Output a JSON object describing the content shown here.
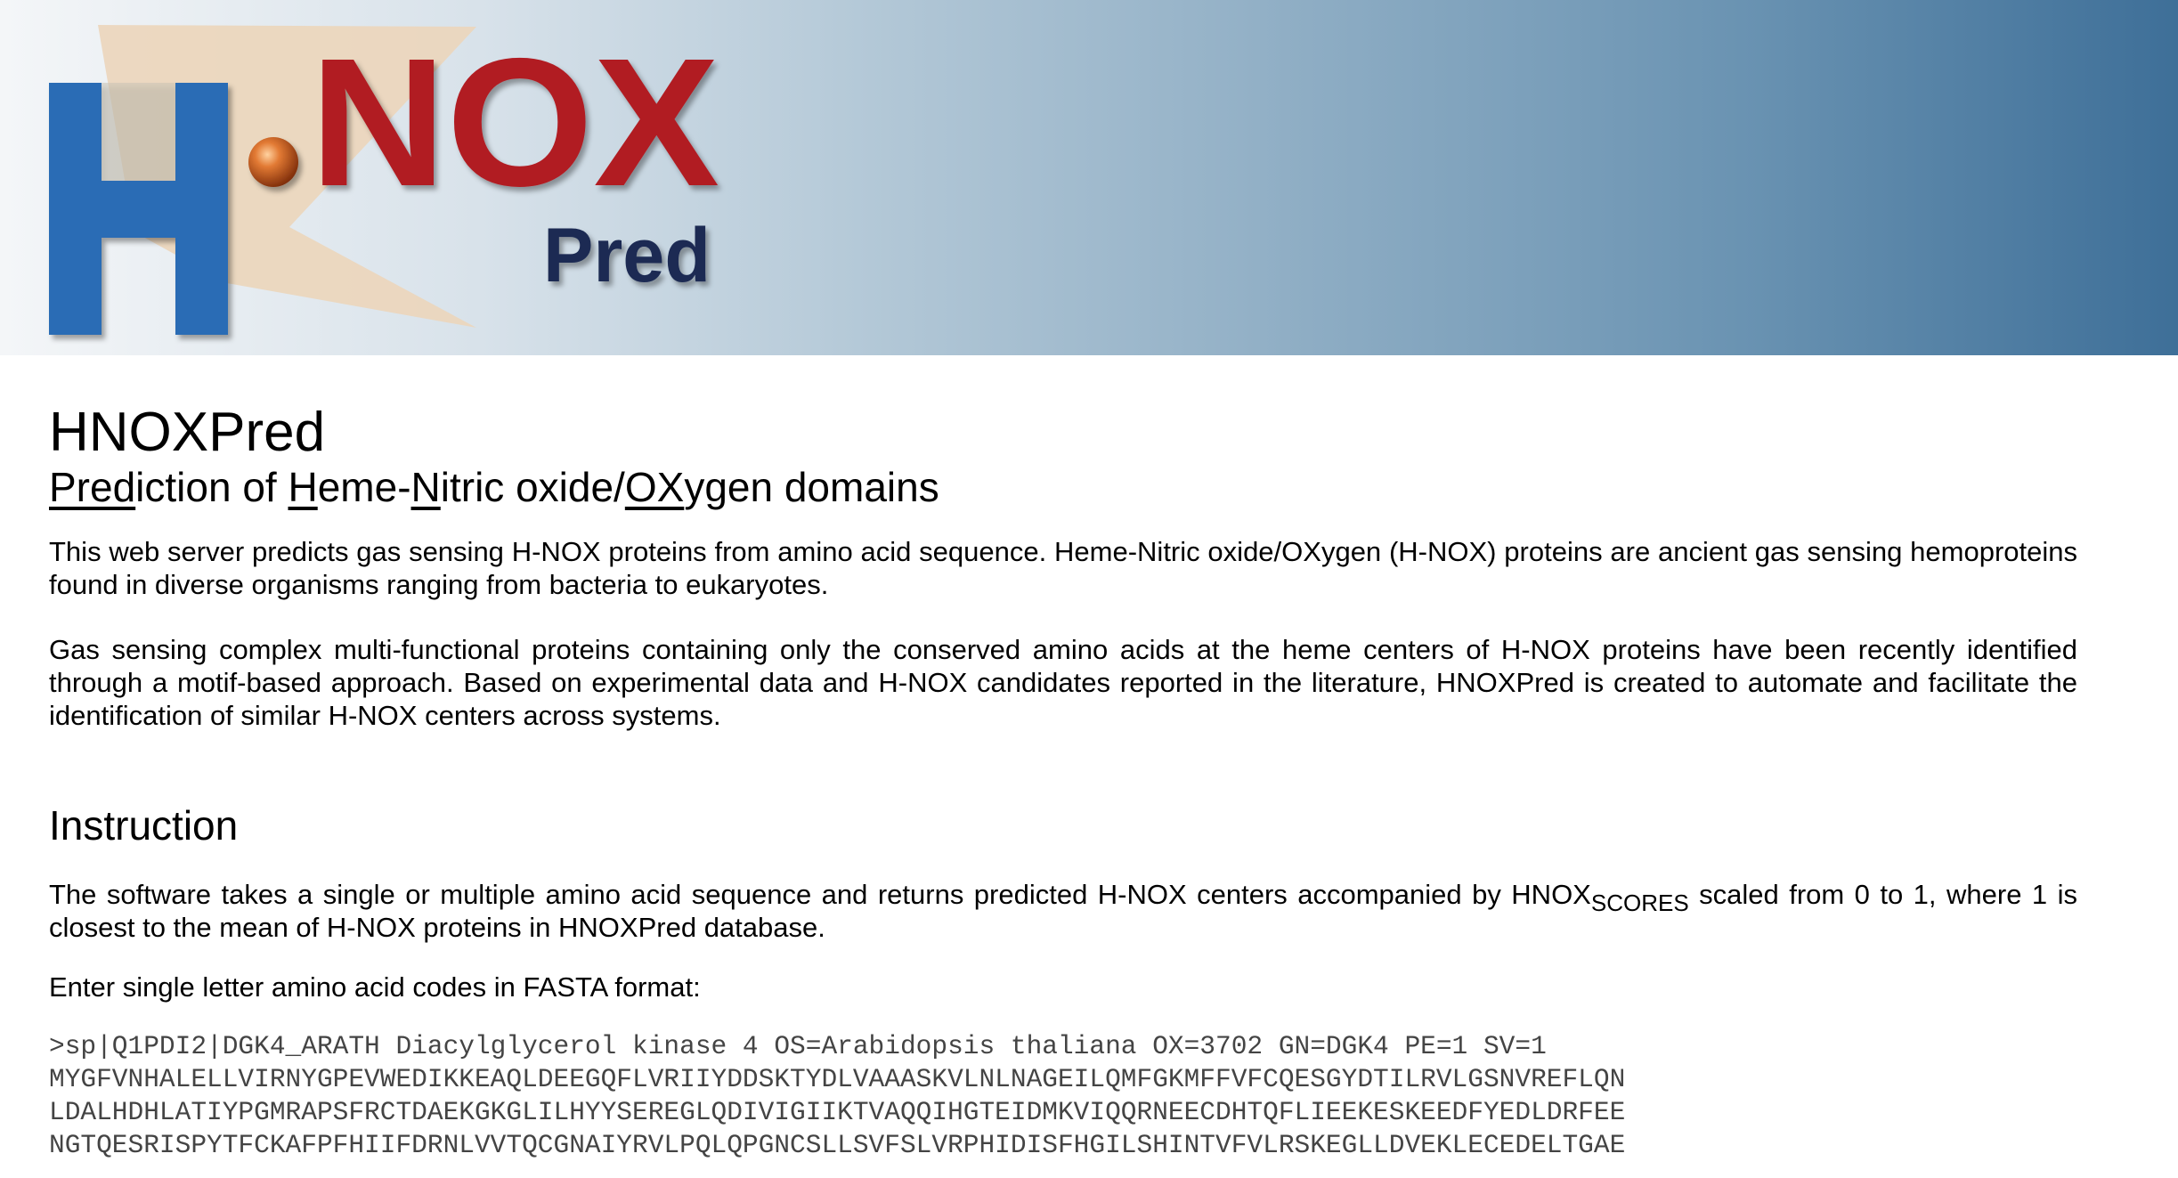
{
  "banner": {
    "logo_letter_h": "H",
    "logo_text_nox": ".NOX",
    "logo_text_pred": "Pred"
  },
  "page": {
    "title": "HNOXPred",
    "subtitle": {
      "pred": "Pred",
      "iction_of": "iction of ",
      "h": "H",
      "eme_dash": "eme-",
      "n": "N",
      "itric_oxide": "itric oxide/",
      "ox": "OX",
      "ygen_domains": "ygen domains"
    },
    "intro_paragraphs": [
      "This web server predicts gas sensing H-NOX proteins from amino acid sequence. Heme-Nitric oxide/OXygen (H-NOX) proteins are ancient gas sensing hemoproteins found in diverse organisms ranging from bacteria to eukaryotes.",
      "Gas sensing complex multi-functional proteins containing only the conserved amino acids at the heme centers of H-NOX proteins have been recently identified through a motif-based approach. Based on experimental data and H-NOX candidates reported in the literature, HNOXPred is created to automate and facilitate the identification of similar H-NOX centers across systems."
    ]
  },
  "instruction": {
    "heading": "Instruction",
    "text_before": "The software takes a single or multiple amino acid sequence and returns predicted H-NOX centers accompanied by HNOX",
    "text_sub": "SCORES",
    "text_after": " scaled from 0 to 1, where 1 is closest to the mean of H-NOX proteins in HNOXPred database.",
    "enter_label": "Enter single letter amino acid codes in FASTA format:",
    "fasta_value": ">sp|Q1PDI2|DGK4_ARATH Diacylglycerol kinase 4 OS=Arabidopsis thaliana OX=3702 GN=DGK4 PE=1 SV=1\nMYGFVNHALELLVIRNYGPEVWEDIKKEAQLDEEGQFLVRIIYDDSKTYDLVAAASKVLNLNAGEILQMFGKMFFVFCQESGYDTILRVLGSNVREFLQN\nLDALHDHLATIYPGMRAPSFRCTDAEKGKGLILHYYSEREGLQDIVIGIIKTVAQQIHGTEIDMKVIQQRNEECDHTQFLIEEKESKEEDFYEDLDRFEE\nNGTQESRISPYTFCKAFPFHIIFDRNLVVTQCGNAIYRVLPQLQPGNCSLLSVFSLVRPHIDISFHGILSHINTVFVLRSKEGLLDVEKLECEDELTGAE"
  },
  "colors": {
    "logo_blue": "#2c6cb5",
    "logo_red": "#b11c23",
    "logo_navy": "#1b2a52",
    "logo_beige": "#ecd6bc",
    "banner_end": "#3e6f98"
  }
}
